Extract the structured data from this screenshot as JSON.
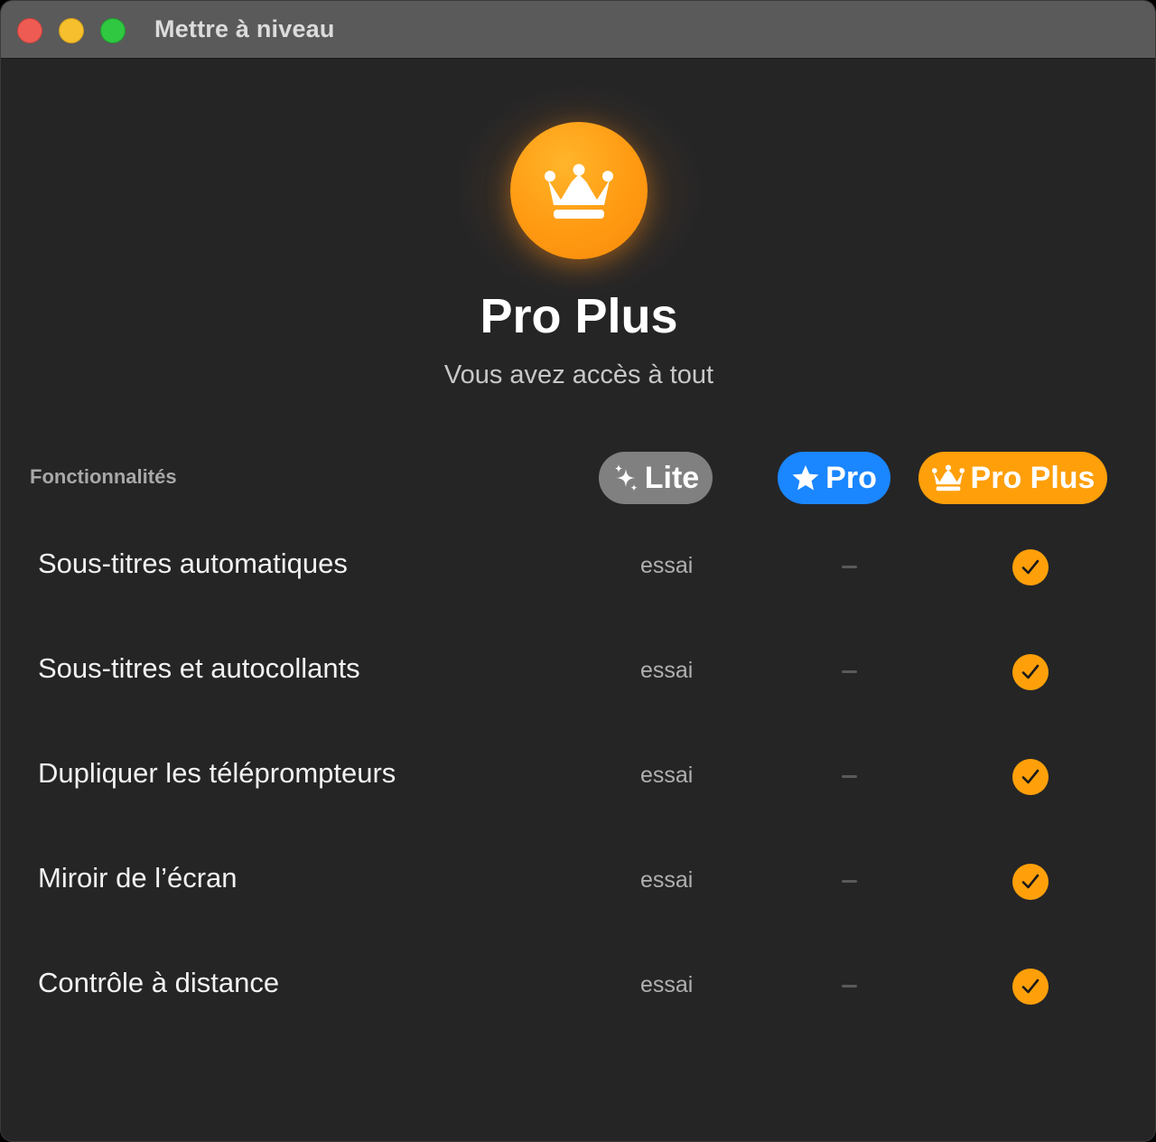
{
  "window": {
    "title": "Mettre à niveau"
  },
  "hero": {
    "icon": "crown-icon",
    "title": "Pro Plus",
    "subtitle": "Vous avez accès à tout",
    "accent": "#FF9F0A"
  },
  "table": {
    "header": "Fonctionnalités",
    "plans": [
      {
        "label": "Lite",
        "icon": "sparkles-icon",
        "color": "#808080"
      },
      {
        "label": "Pro",
        "icon": "star-icon",
        "color": "#1A86FF"
      },
      {
        "label": "Pro Plus",
        "icon": "crown-icon",
        "color": "#FF9F0A"
      }
    ],
    "rows": [
      {
        "feature": "Sous-titres automatiques",
        "lite": "essai",
        "pro": "—",
        "pro_plus": "check"
      },
      {
        "feature": "Sous-titres et autocollants",
        "lite": "essai",
        "pro": "—",
        "pro_plus": "check"
      },
      {
        "feature": "Dupliquer les téléprompteurs",
        "lite": "essai",
        "pro": "—",
        "pro_plus": "check"
      },
      {
        "feature": "Miroir de l’écran",
        "lite": "essai",
        "pro": "—",
        "pro_plus": "check"
      },
      {
        "feature": "Contrôle à distance",
        "lite": "essai",
        "pro": "—",
        "pro_plus": "check"
      }
    ]
  }
}
